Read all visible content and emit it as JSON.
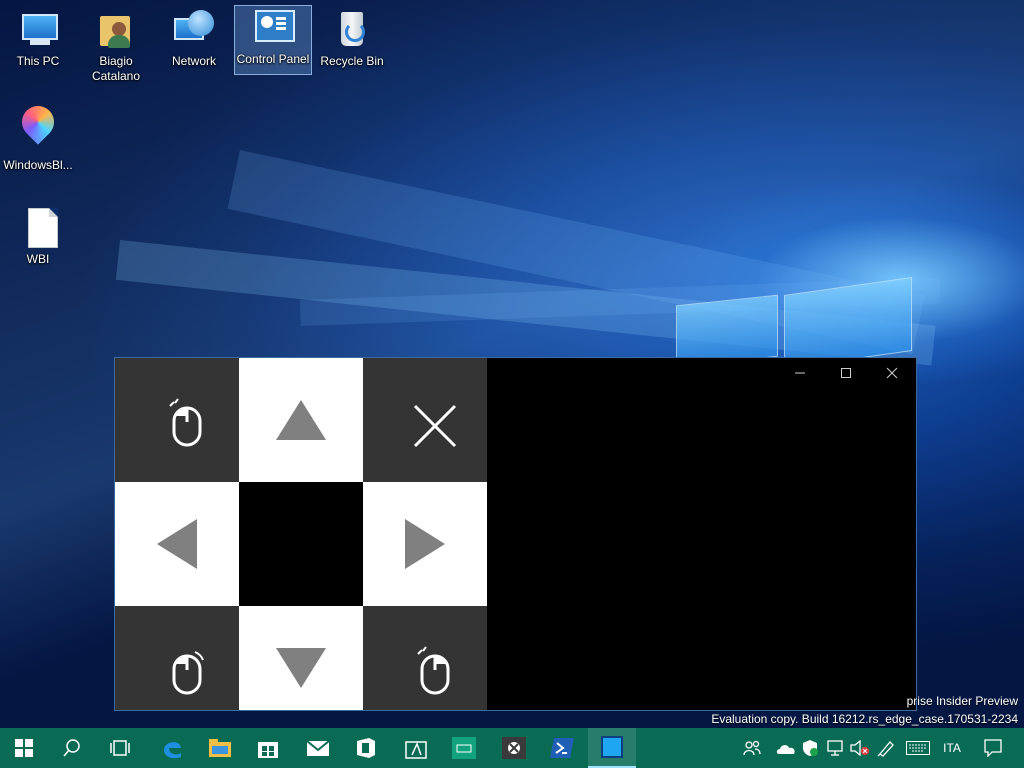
{
  "desktop": {
    "icons": [
      {
        "label": "This PC",
        "icon": "computer-icon"
      },
      {
        "label": "Biagio Catalano",
        "icon": "user-folder-icon"
      },
      {
        "label": "Network",
        "icon": "network-icon"
      },
      {
        "label": "Control Panel",
        "icon": "control-panel-icon",
        "selected": true
      },
      {
        "label": "Recycle Bin",
        "icon": "recycle-bin-icon"
      },
      {
        "label": "WindowsBl...",
        "icon": "paint-3d-icon"
      },
      {
        "label": "WBI",
        "icon": "document-icon"
      }
    ],
    "user_label_line1": "Biagio",
    "user_label_line2": "Catalano"
  },
  "app_window": {
    "controls": [
      "minimize-icon",
      "maximize-icon",
      "close-icon"
    ],
    "pad": {
      "top_left": "mouse-left-click-icon",
      "top_center": "arrow-up-icon",
      "top_right": "close-x-icon",
      "middle_left": "arrow-left-icon",
      "center": "blank",
      "middle_right": "arrow-right-icon",
      "bottom_left": "mouse-left-drag-icon",
      "bottom_center": "arrow-down-icon",
      "bottom_right": "mouse-right-click-icon"
    }
  },
  "watermark": {
    "line1": "prise Insider Preview",
    "line2": "Evaluation copy. Build 16212.rs_edge_case.170531-2234"
  },
  "taskbar": {
    "items": [
      "start-icon",
      "search-icon",
      "task-view-icon",
      "edge-icon",
      "file-explorer-icon",
      "store-icon",
      "mail-icon",
      "office-icon",
      "whiteboard-icon",
      "keyboard-app-icon",
      "xbox-icon",
      "powershell-icon",
      "active-app-icon"
    ],
    "tray": [
      "people-icon",
      "onedrive-icon",
      "defender-icon",
      "network-icon",
      "volume-muted-icon",
      "pen-icon",
      "touch-keyboard-icon"
    ],
    "language": "ITA",
    "notification": "action-center-icon"
  },
  "colors": {
    "taskbar": "#0a6b55",
    "pad_dark": "#343434",
    "pad_light": "#ffffff",
    "arrow_gray": "#808080"
  }
}
